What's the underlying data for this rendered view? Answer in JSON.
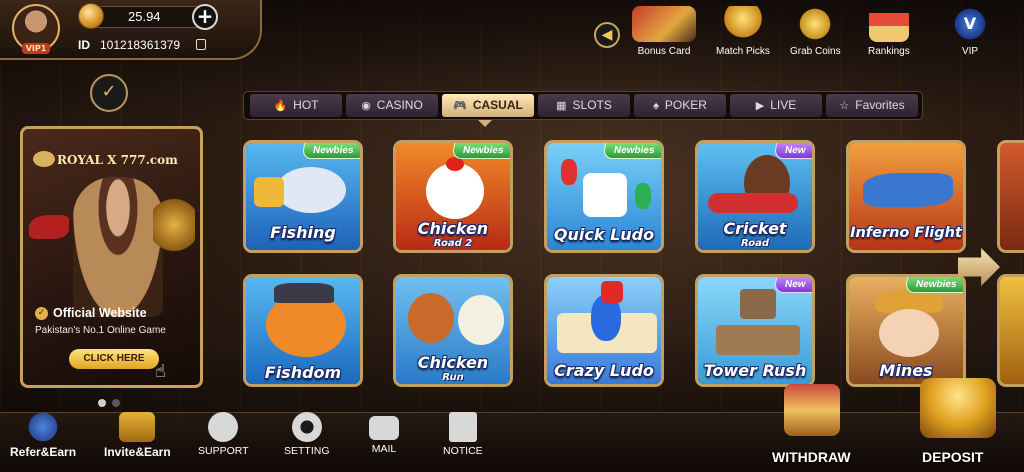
{
  "profile": {
    "vip_tag": "VIP1",
    "balance": "25.94",
    "id_label": "ID",
    "id_value": "101218361379"
  },
  "top_menu": [
    {
      "label": "Bonus Card",
      "icon": "bonus-card-icon"
    },
    {
      "label": "Match Picks",
      "icon": "trophy-icon"
    },
    {
      "label": "Grab Coins",
      "icon": "coins-icon"
    },
    {
      "label": "Rankings",
      "icon": "podium-icon"
    },
    {
      "label": "VIP",
      "icon": "vip-crown-icon"
    }
  ],
  "tabs": [
    {
      "label": "HOT",
      "icon": "flame-icon",
      "active": false
    },
    {
      "label": "CASINO",
      "icon": "chip-icon",
      "active": false
    },
    {
      "label": "CASUAL",
      "icon": "gamepad-icon",
      "active": true
    },
    {
      "label": "SLOTS",
      "icon": "slot-icon",
      "active": false
    },
    {
      "label": "POKER",
      "icon": "cards-icon",
      "active": false
    },
    {
      "label": "LIVE",
      "icon": "camera-icon",
      "active": false
    },
    {
      "label": "Favorites",
      "icon": "star-icon",
      "active": false
    }
  ],
  "promo": {
    "brand": "ROYAL X 777.com",
    "official": "Official Website",
    "subtitle": "Pakistan's No.1 Online Game",
    "button": "CLICK HERE"
  },
  "games": [
    {
      "title": "Fishing",
      "sub": "",
      "badge": "Newbies",
      "badge_type": "newbies",
      "theme": "#2f86d8"
    },
    {
      "title": "Chicken",
      "sub": "Road 2",
      "badge": "Newbies",
      "badge_type": "newbies",
      "theme": "#d2541e"
    },
    {
      "title": "Quick Ludo",
      "sub": "",
      "badge": "Newbies",
      "badge_type": "newbies",
      "theme": "#3aa4e4"
    },
    {
      "title": "Cricket",
      "sub": "Road",
      "badge": "New",
      "badge_type": "new",
      "theme": "#2b9bd0"
    },
    {
      "title": "Inferno Flight",
      "sub": "",
      "badge": "",
      "badge_type": "",
      "theme": "#d84a28"
    },
    {
      "title": "Fishdom",
      "sub": "",
      "badge": "",
      "badge_type": "",
      "theme": "#28a0e0"
    },
    {
      "title": "Chicken",
      "sub": "Run",
      "badge": "",
      "badge_type": "",
      "theme": "#3a8fd0"
    },
    {
      "title": "Crazy Ludo",
      "sub": "",
      "badge": "",
      "badge_type": "",
      "theme": "#4c8fe0"
    },
    {
      "title": "Tower Rush",
      "sub": "",
      "badge": "New",
      "badge_type": "new",
      "theme": "#4eb0e8"
    },
    {
      "title": "Mines",
      "sub": "",
      "badge": "Newbies",
      "badge_type": "newbies",
      "theme": "#c87a30"
    }
  ],
  "bottom_nav": [
    {
      "label": "Refer&Earn",
      "icon": "megaphone-icon"
    },
    {
      "label": "Invite&Earn",
      "icon": "gift-box-icon"
    },
    {
      "label": "SUPPORT",
      "icon": "chat-bubble-icon"
    },
    {
      "label": "SETTING",
      "icon": "gear-icon"
    },
    {
      "label": "MAIL",
      "icon": "mail-icon"
    },
    {
      "label": "NOTICE",
      "icon": "notice-icon"
    }
  ],
  "withdraw_label": "WITHDRAW",
  "deposit_label": "DEPOSIT"
}
